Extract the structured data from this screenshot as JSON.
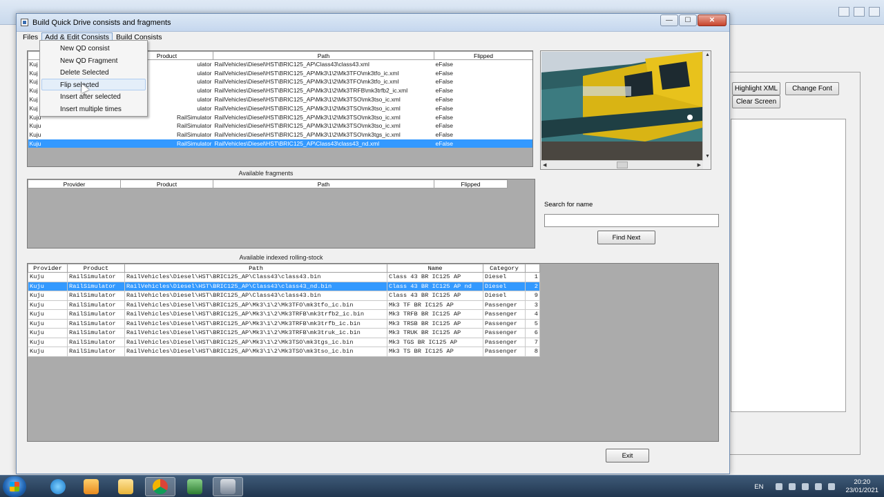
{
  "window": {
    "title": "Build Quick Drive consists and fragments",
    "controls": {
      "minimize": "—",
      "maximize": "☐",
      "close": "✕"
    }
  },
  "menubar": {
    "items": [
      "Files",
      "Add & Edit Consists",
      "Build Consists"
    ]
  },
  "dropdown": {
    "items": [
      "New QD consist",
      "New QD Fragment",
      "Delete Selected",
      "Flip selected",
      "Insert after selected",
      "Insert multiple times"
    ]
  },
  "consist_grid": {
    "headers": [
      "",
      "Product",
      "Path",
      "Flipped"
    ],
    "rows": [
      {
        "provider": "Kuj",
        "product": "ulator",
        "path": "RailVehicles\\Diesel\\HST\\BRIC125_AP\\Class43\\class43.xml",
        "flipped": "eFalse"
      },
      {
        "provider": "Kuj",
        "product": "ulator",
        "path": "RailVehicles\\Diesel\\HST\\BRIC125_AP\\Mk3\\1\\2\\Mk3TFO\\mk3tfo_ic.xml",
        "flipped": "eFalse"
      },
      {
        "provider": "Kuj",
        "product": "ulator",
        "path": "RailVehicles\\Diesel\\HST\\BRIC125_AP\\Mk3\\1\\2\\Mk3TFO\\mk3tfo_ic.xml",
        "flipped": "eFalse"
      },
      {
        "provider": "Kuj",
        "product": "ulator",
        "path": "RailVehicles\\Diesel\\HST\\BRIC125_AP\\Mk3\\1\\2\\Mk3TRFB\\mk3trfb2_ic.xml",
        "flipped": "eFalse"
      },
      {
        "provider": "Kuj",
        "product": "ulator",
        "path": "RailVehicles\\Diesel\\HST\\BRIC125_AP\\Mk3\\1\\2\\Mk3TSO\\mk3tso_ic.xml",
        "flipped": "eFalse"
      },
      {
        "provider": "Kuj",
        "product": "ulator",
        "path": "RailVehicles\\Diesel\\HST\\BRIC125_AP\\Mk3\\1\\2\\Mk3TSO\\mk3tso_ic.xml",
        "flipped": "eFalse"
      },
      {
        "provider": "Kuju",
        "product": "RailSimulator",
        "path": "RailVehicles\\Diesel\\HST\\BRIC125_AP\\Mk3\\1\\2\\Mk3TSO\\mk3tso_ic.xml",
        "flipped": "eFalse"
      },
      {
        "provider": "Kuju",
        "product": "RailSimulator",
        "path": "RailVehicles\\Diesel\\HST\\BRIC125_AP\\Mk3\\1\\2\\Mk3TSO\\mk3tso_ic.xml",
        "flipped": "eFalse"
      },
      {
        "provider": "Kuju",
        "product": "RailSimulator",
        "path": "RailVehicles\\Diesel\\HST\\BRIC125_AP\\Mk3\\1\\2\\Mk3TSO\\mk3tgs_ic.xml",
        "flipped": "eFalse"
      },
      {
        "provider": "Kuju",
        "product": "RailSimulator",
        "path": "RailVehicles\\Diesel\\HST\\BRIC125_AP\\Class43\\class43_nd.xml",
        "flipped": "eFalse"
      }
    ]
  },
  "fragments": {
    "caption": "Available fragments",
    "headers": [
      "Provider",
      "Product",
      "Path",
      "Flipped"
    ]
  },
  "rolling_stock": {
    "caption": "Available indexed rolling-stock",
    "headers": [
      "Provider",
      "Product",
      "Path",
      "Name",
      "Category",
      ""
    ],
    "rows": [
      {
        "provider": "Kuju",
        "product": "RailSimulator",
        "path": "RailVehicles\\Diesel\\HST\\BRIC125_AP\\Class43\\class43.bin",
        "name": "Class 43 BR IC125 AP",
        "category": "Diesel",
        "n": "1"
      },
      {
        "provider": "Kuju",
        "product": "RailSimulator",
        "path": "RailVehicles\\Diesel\\HST\\BRIC125_AP\\Class43\\class43_nd.bin",
        "name": "Class 43 BR IC125 AP nd",
        "category": "Diesel",
        "n": "2"
      },
      {
        "provider": "Kuju",
        "product": "RailSimulator",
        "path": "RailVehicles\\Diesel\\HST\\BRIC125_AP\\Class43\\class43.bin",
        "name": "Class 43 BR IC125 AP",
        "category": "Diesel",
        "n": "9"
      },
      {
        "provider": "Kuju",
        "product": "RailSimulator",
        "path": "RailVehicles\\Diesel\\HST\\BRIC125_AP\\Mk3\\1\\2\\Mk3TFO\\mk3tfo_ic.bin",
        "name": "Mk3 TF BR IC125 AP",
        "category": "Passenger",
        "n": "3"
      },
      {
        "provider": "Kuju",
        "product": "RailSimulator",
        "path": "RailVehicles\\Diesel\\HST\\BRIC125_AP\\Mk3\\1\\2\\Mk3TRFB\\mk3trfb2_ic.bin",
        "name": "Mk3 TRFB BR IC125 AP",
        "category": "Passenger",
        "n": "4"
      },
      {
        "provider": "Kuju",
        "product": "RailSimulator",
        "path": "RailVehicles\\Diesel\\HST\\BRIC125_AP\\Mk3\\1\\2\\Mk3TRFB\\mk3trfb_ic.bin",
        "name": "Mk3 TRSB BR IC125 AP",
        "category": "Passenger",
        "n": "5"
      },
      {
        "provider": "Kuju",
        "product": "RailSimulator",
        "path": "RailVehicles\\Diesel\\HST\\BRIC125_AP\\Mk3\\1\\2\\Mk3TRFB\\mk3truk_ic.bin",
        "name": "Mk3 TRUK BR IC125 AP",
        "category": "Passenger",
        "n": "6"
      },
      {
        "provider": "Kuju",
        "product": "RailSimulator",
        "path": "RailVehicles\\Diesel\\HST\\BRIC125_AP\\Mk3\\1\\2\\Mk3TSO\\mk3tgs_ic.bin",
        "name": "Mk3 TGS BR IC125 AP",
        "category": "Passenger",
        "n": "7"
      },
      {
        "provider": "Kuju",
        "product": "RailSimulator",
        "path": "RailVehicles\\Diesel\\HST\\BRIC125_AP\\Mk3\\1\\2\\Mk3TSO\\mk3tso_ic.bin",
        "name": "Mk3 TS BR IC125 AP",
        "category": "Passenger",
        "n": "8"
      }
    ]
  },
  "search": {
    "label": "Search for name",
    "value": "",
    "find_next": "Find Next"
  },
  "exit_label": "Exit",
  "background_app": {
    "highlight_xml": "Highlight XML",
    "change_font": "Change Font",
    "clear_screen": "Clear Screen"
  },
  "taskbar": {
    "lang": "EN",
    "time": "20:20",
    "date": "23/01/2021"
  },
  "colors": {
    "selection": "#3399ff",
    "grid_bg": "#ababab"
  }
}
